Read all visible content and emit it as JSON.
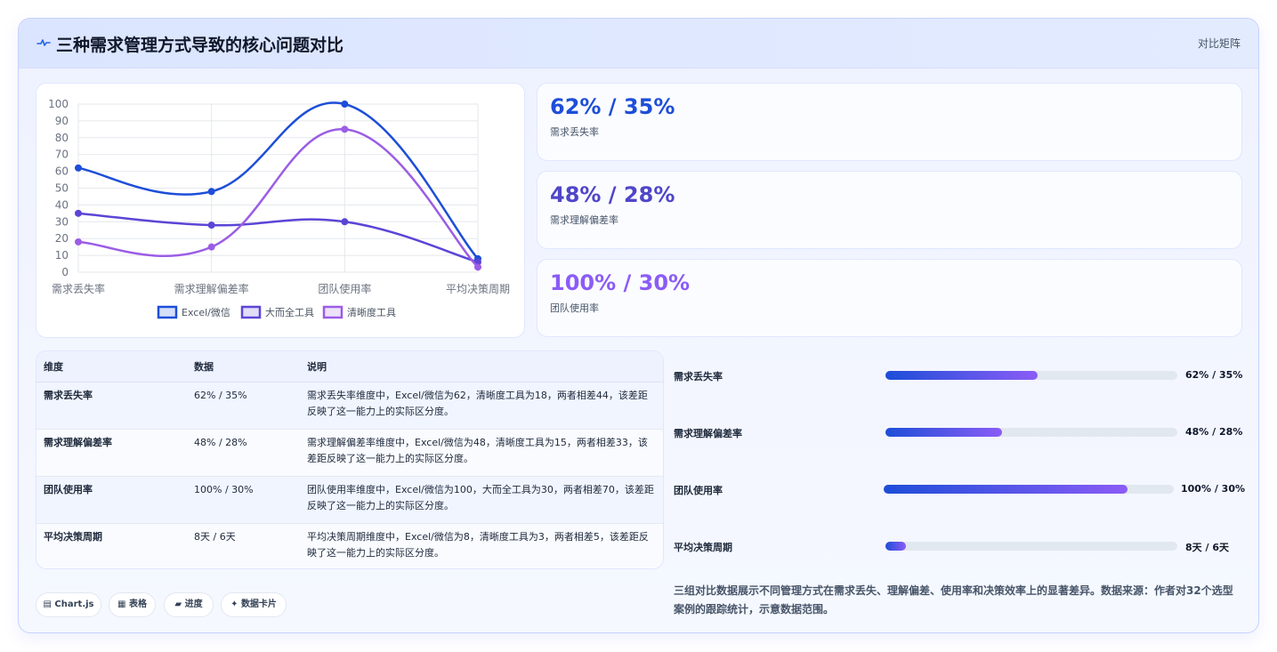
{
  "header": {
    "title": "三种需求管理方式导致的核心问题对比",
    "tag": "对比矩阵",
    "icon": "pulse-icon"
  },
  "colors": {
    "excel": "#1d4ed8",
    "full": "#5b45d6",
    "clarity": "#9b5de5",
    "accent": "#8b5cf6"
  },
  "chart_data": {
    "type": "line",
    "categories": [
      "需求丢失率",
      "需求理解偏差率",
      "团队使用率",
      "平均决策周期"
    ],
    "series": [
      {
        "name": "Excel/微信",
        "values": [
          62,
          48,
          100,
          8
        ]
      },
      {
        "name": "大而全工具",
        "values": [
          35,
          28,
          30,
          6
        ]
      },
      {
        "name": "清晰度工具",
        "values": [
          18,
          15,
          85,
          3
        ]
      }
    ],
    "ylim": [
      0,
      100
    ],
    "yticks": [
      "0",
      "10",
      "20",
      "30",
      "40",
      "50",
      "60",
      "70",
      "80",
      "90",
      "100"
    ],
    "grid": true,
    "legend": "bottom"
  },
  "stats": [
    {
      "value": "62% / 35%",
      "label": "需求丢失率"
    },
    {
      "value": "48% / 28%",
      "label": "需求理解偏差率"
    },
    {
      "value": "100% / 30%",
      "label": "团队使用率"
    }
  ],
  "table": {
    "headers": [
      "维度",
      "数据",
      "说明"
    ],
    "rows": [
      [
        "需求丢失率",
        "62% / 35%",
        "需求丢失率维度中，Excel/微信为62，清晰度工具为18，两者相差44，该差距反映了这一能力上的实际区分度。"
      ],
      [
        "需求理解偏差率",
        "48% / 28%",
        "需求理解偏差率维度中，Excel/微信为48，清晰度工具为15，两者相差33，该差距反映了这一能力上的实际区分度。"
      ],
      [
        "团队使用率",
        "100% / 30%",
        "团队使用率维度中，Excel/微信为100，大而全工具为30，两者相差70，该差距反映了这一能力上的实际区分度。"
      ],
      [
        "平均决策周期",
        "8天 / 6天",
        "平均决策周期维度中，Excel/微信为8，清晰度工具为3，两者相差5，该差距反映了这一能力上的实际区分度。"
      ]
    ]
  },
  "progress": [
    {
      "label": "需求丢失率",
      "value": "62% / 35%",
      "fill": 0.52
    },
    {
      "label": "需求理解偏差率",
      "value": "48% / 28%",
      "fill": 0.4
    },
    {
      "label": "团队使用率",
      "value": "100% / 30%",
      "fill": 0.84
    },
    {
      "label": "平均决策周期",
      "value": "8天 / 6天",
      "fill": 0.07
    }
  ],
  "badges": [
    {
      "label": "Chart.js",
      "icon": "chart-icon"
    },
    {
      "label": "表格",
      "icon": "table-icon"
    },
    {
      "label": "进度",
      "icon": "progress-icon"
    },
    {
      "label": "数据卡片",
      "icon": "sparkle-icon"
    }
  ],
  "footnote": "三组对比数据展示不同管理方式在需求丢失、理解偏差、使用率和决策效率上的显著差异。数据来源：作者对32个选型案例的跟踪统计，示意数据范围。"
}
